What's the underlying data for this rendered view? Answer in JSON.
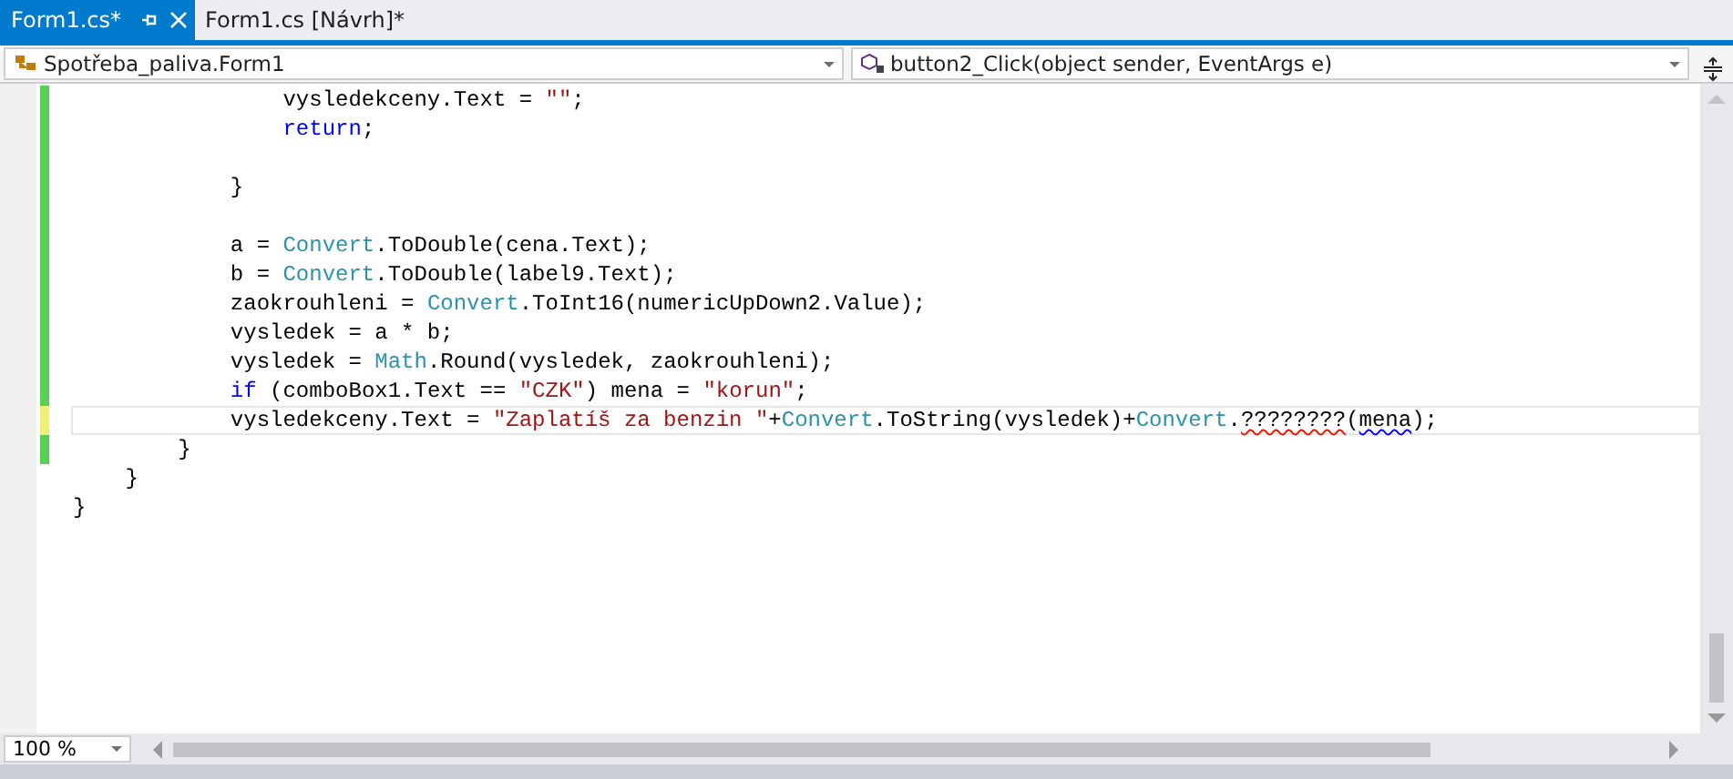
{
  "tabs": [
    {
      "label": "Form1.cs*",
      "selected": true,
      "pinnable": true
    },
    {
      "label": "Form1.cs [Návrh]*",
      "selected": false,
      "pinnable": false
    }
  ],
  "navigation": {
    "type_dropdown": "Spotřeba_paliva.Form1",
    "member_dropdown": "button2_Click(object sender, EventArgs e)"
  },
  "code_lines": [
    {
      "changed": true,
      "unsaved": false,
      "current": false,
      "tokens": [
        {
          "kind": "plain",
          "text": "                vysledekceny.Text = "
        },
        {
          "kind": "string",
          "text": "\"\""
        },
        {
          "kind": "plain",
          "text": ";"
        }
      ]
    },
    {
      "changed": true,
      "unsaved": false,
      "current": false,
      "tokens": [
        {
          "kind": "keyword",
          "text": "                return"
        },
        {
          "kind": "plain",
          "text": ";"
        }
      ]
    },
    {
      "changed": true,
      "unsaved": false,
      "current": false
    },
    {
      "changed": true,
      "unsaved": false,
      "current": false,
      "tokens": [
        {
          "kind": "plain",
          "text": "            }"
        }
      ]
    },
    {
      "changed": true,
      "unsaved": false,
      "current": false
    },
    {
      "changed": true,
      "unsaved": false,
      "current": false,
      "tokens": [
        {
          "kind": "plain",
          "text": "            a = "
        },
        {
          "kind": "type",
          "text": "Convert"
        },
        {
          "kind": "plain",
          "text": ".ToDouble(cena.Text);"
        }
      ]
    },
    {
      "changed": true,
      "unsaved": false,
      "current": false,
      "tokens": [
        {
          "kind": "plain",
          "text": "            b = "
        },
        {
          "kind": "type",
          "text": "Convert"
        },
        {
          "kind": "plain",
          "text": ".ToDouble(label9.Text);"
        }
      ]
    },
    {
      "changed": true,
      "unsaved": false,
      "current": false,
      "tokens": [
        {
          "kind": "plain",
          "text": "            zaokrouhleni = "
        },
        {
          "kind": "type",
          "text": "Convert"
        },
        {
          "kind": "plain",
          "text": ".ToInt16(numericUpDown2.Value);"
        }
      ]
    },
    {
      "changed": true,
      "unsaved": false,
      "current": false,
      "tokens": [
        {
          "kind": "plain",
          "text": "            vysledek = a * b;"
        }
      ]
    },
    {
      "changed": true,
      "unsaved": false,
      "current": false,
      "tokens": [
        {
          "kind": "plain",
          "text": "            vysledek = "
        },
        {
          "kind": "type",
          "text": "Math"
        },
        {
          "kind": "plain",
          "text": ".Round(vysledek, zaokrouhleni);"
        }
      ]
    },
    {
      "changed": true,
      "unsaved": false,
      "current": false,
      "tokens": [
        {
          "kind": "keyword",
          "text": "            if"
        },
        {
          "kind": "plain",
          "text": " (comboBox1.Text == "
        },
        {
          "kind": "string",
          "text": "\"CZK\""
        },
        {
          "kind": "plain",
          "text": ") mena = "
        },
        {
          "kind": "string",
          "text": "\"korun\""
        },
        {
          "kind": "plain",
          "text": ";"
        }
      ]
    },
    {
      "changed": true,
      "unsaved": true,
      "current": true,
      "tokens": [
        {
          "kind": "plain",
          "text": "            vysledekceny.Text = "
        },
        {
          "kind": "string",
          "text": "\"Zaplatíš za benzin \""
        },
        {
          "kind": "plain",
          "text": "+"
        },
        {
          "kind": "type",
          "text": "Convert"
        },
        {
          "kind": "plain",
          "text": ".ToString(vysledek)+"
        },
        {
          "kind": "type",
          "text": "Convert"
        },
        {
          "kind": "plain",
          "text": "."
        },
        {
          "kind": "error",
          "text": "????????"
        },
        {
          "kind": "plain",
          "text": "("
        },
        {
          "kind": "warning",
          "text": "mena"
        },
        {
          "kind": "plain",
          "text": ");"
        }
      ]
    },
    {
      "changed": true,
      "unsaved": false,
      "current": false,
      "tokens": [
        {
          "kind": "plain",
          "text": "        }"
        }
      ]
    },
    {
      "changed": false,
      "current": false,
      "tokens": [
        {
          "kind": "plain",
          "text": "    }"
        }
      ]
    },
    {
      "changed": false,
      "current": false,
      "tokens": [
        {
          "kind": "plain",
          "text": "}"
        }
      ]
    }
  ],
  "zoom": "100 %"
}
